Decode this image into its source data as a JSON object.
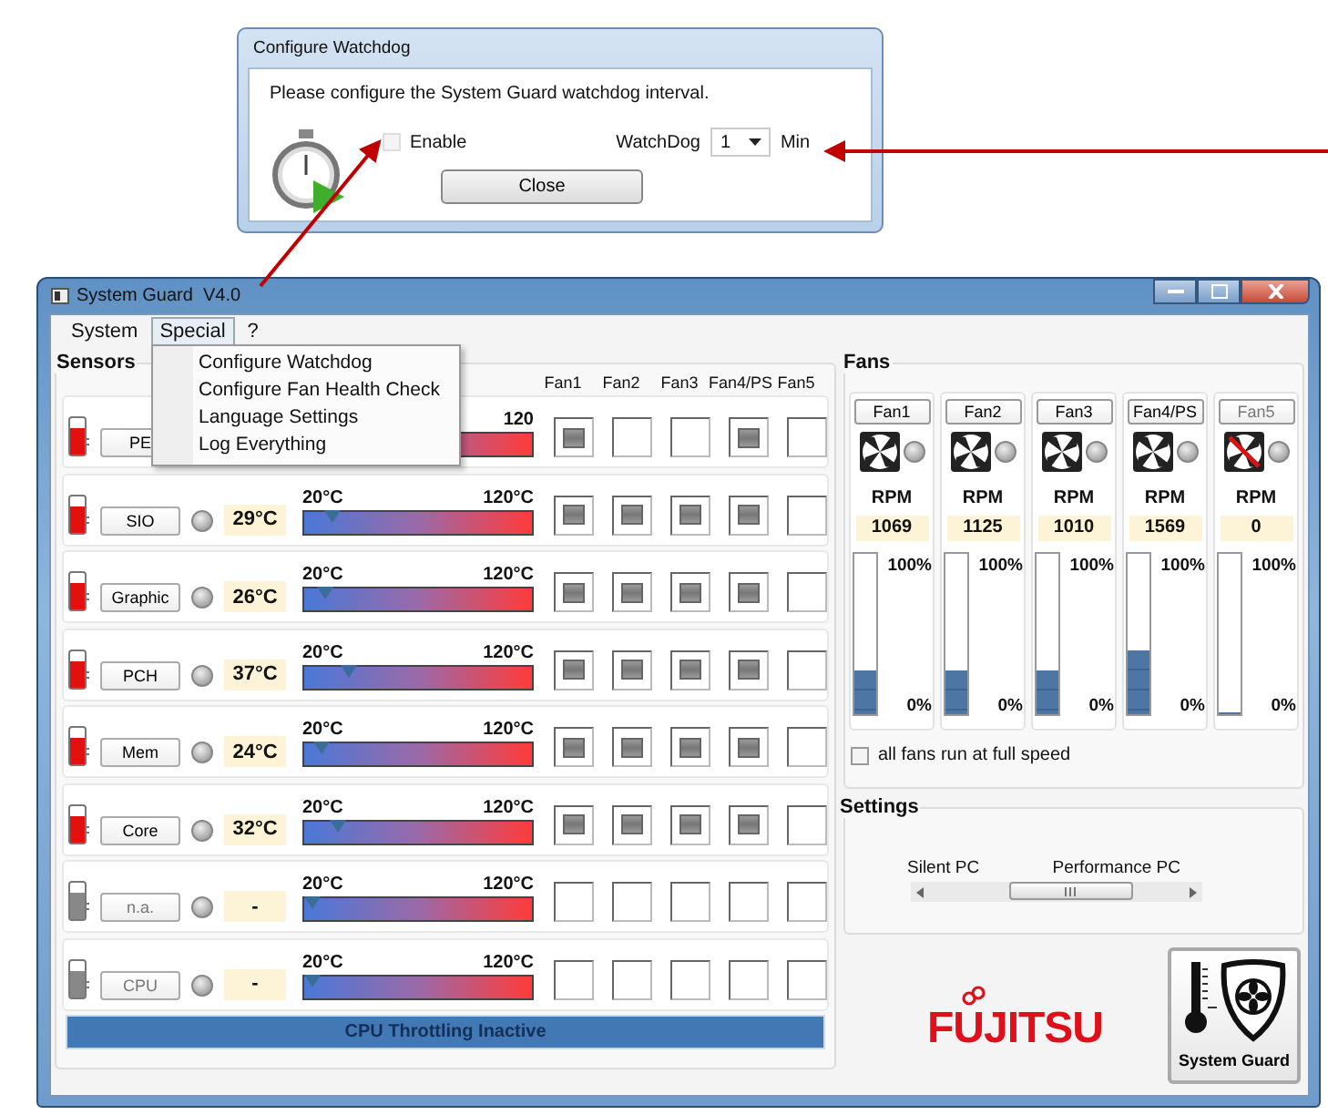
{
  "dialog": {
    "title": "Configure Watchdog",
    "message": "Please configure the System Guard watchdog interval.",
    "enable": {
      "label": "Enable",
      "checked": false
    },
    "watchdog_label": "WatchDog",
    "interval": "1",
    "unit": "Min",
    "close_button": "Close"
  },
  "window": {
    "title": "System Guard  V4.0"
  },
  "menu": [
    {
      "label": "System",
      "selected": false
    },
    {
      "label": "Special",
      "selected": true
    },
    {
      "label": "?",
      "selected": false
    }
  ],
  "dropdown": [
    "Configure Watchdog",
    "Configure Fan Health Check",
    "Language Settings",
    "Log Everything"
  ],
  "sensors": {
    "title": "Sensors",
    "fan_headers": [
      "Fan1",
      "Fan2",
      "Fan3",
      "Fan4/PS",
      "Fan5"
    ],
    "rows": [
      {
        "name": "PE",
        "active": true,
        "max": "120",
        "fans": [
          true,
          false,
          false,
          true,
          false
        ]
      },
      {
        "name": "SIO",
        "active": true,
        "temp": "29°C",
        "min": "20°C",
        "max": "120°C",
        "level": 0.09,
        "fans": [
          true,
          true,
          true,
          true,
          false
        ]
      },
      {
        "name": "Graphic",
        "active": true,
        "temp": "26°C",
        "min": "20°C",
        "max": "120°C",
        "level": 0.06,
        "fans": [
          true,
          true,
          true,
          true,
          false
        ]
      },
      {
        "name": "PCH",
        "active": true,
        "temp": "37°C",
        "min": "20°C",
        "max": "120°C",
        "level": 0.17,
        "fans": [
          true,
          true,
          true,
          true,
          false
        ]
      },
      {
        "name": "Mem",
        "active": true,
        "temp": "24°C",
        "min": "20°C",
        "max": "120°C",
        "level": 0.04,
        "fans": [
          true,
          true,
          true,
          true,
          false
        ]
      },
      {
        "name": "Core",
        "active": true,
        "temp": "32°C",
        "min": "20°C",
        "max": "120°C",
        "level": 0.12,
        "fans": [
          true,
          true,
          true,
          true,
          false
        ]
      },
      {
        "name": "n.a.",
        "active": false,
        "temp": "-",
        "min": "20°C",
        "max": "120°C",
        "level": 0,
        "fans": [
          false,
          false,
          false,
          false,
          false
        ]
      },
      {
        "name": "CPU",
        "active": false,
        "temp": "-",
        "min": "20°C",
        "max": "120°C",
        "level": 0,
        "fans": [
          false,
          false,
          false,
          false,
          false
        ]
      }
    ],
    "status": "CPU Throttling Inactive"
  },
  "fans": {
    "title": "Fans",
    "items": [
      {
        "name": "Fan1",
        "failed": false,
        "unit": "RPM",
        "rpm": "1069",
        "level": 0.27,
        "max": "100%",
        "min": "0%"
      },
      {
        "name": "Fan2",
        "failed": false,
        "unit": "RPM",
        "rpm": "1125",
        "level": 0.27,
        "max": "100%",
        "min": "0%"
      },
      {
        "name": "Fan3",
        "failed": false,
        "unit": "RPM",
        "rpm": "1010",
        "level": 0.27,
        "max": "100%",
        "min": "0%"
      },
      {
        "name": "Fan4/PS",
        "failed": false,
        "unit": "RPM",
        "rpm": "1569",
        "level": 0.4,
        "max": "100%",
        "min": "0%"
      },
      {
        "name": "Fan5",
        "failed": true,
        "unit": "RPM",
        "rpm": "0",
        "level": 0,
        "max": "100%",
        "min": "0%"
      }
    ],
    "full_speed": {
      "label": "all fans run at full speed",
      "checked": false
    }
  },
  "settings": {
    "title": "Settings",
    "left": "Silent PC",
    "right": "Performance PC",
    "level": 0.58
  },
  "logo": "FUJITSU",
  "app_button": "System Guard"
}
